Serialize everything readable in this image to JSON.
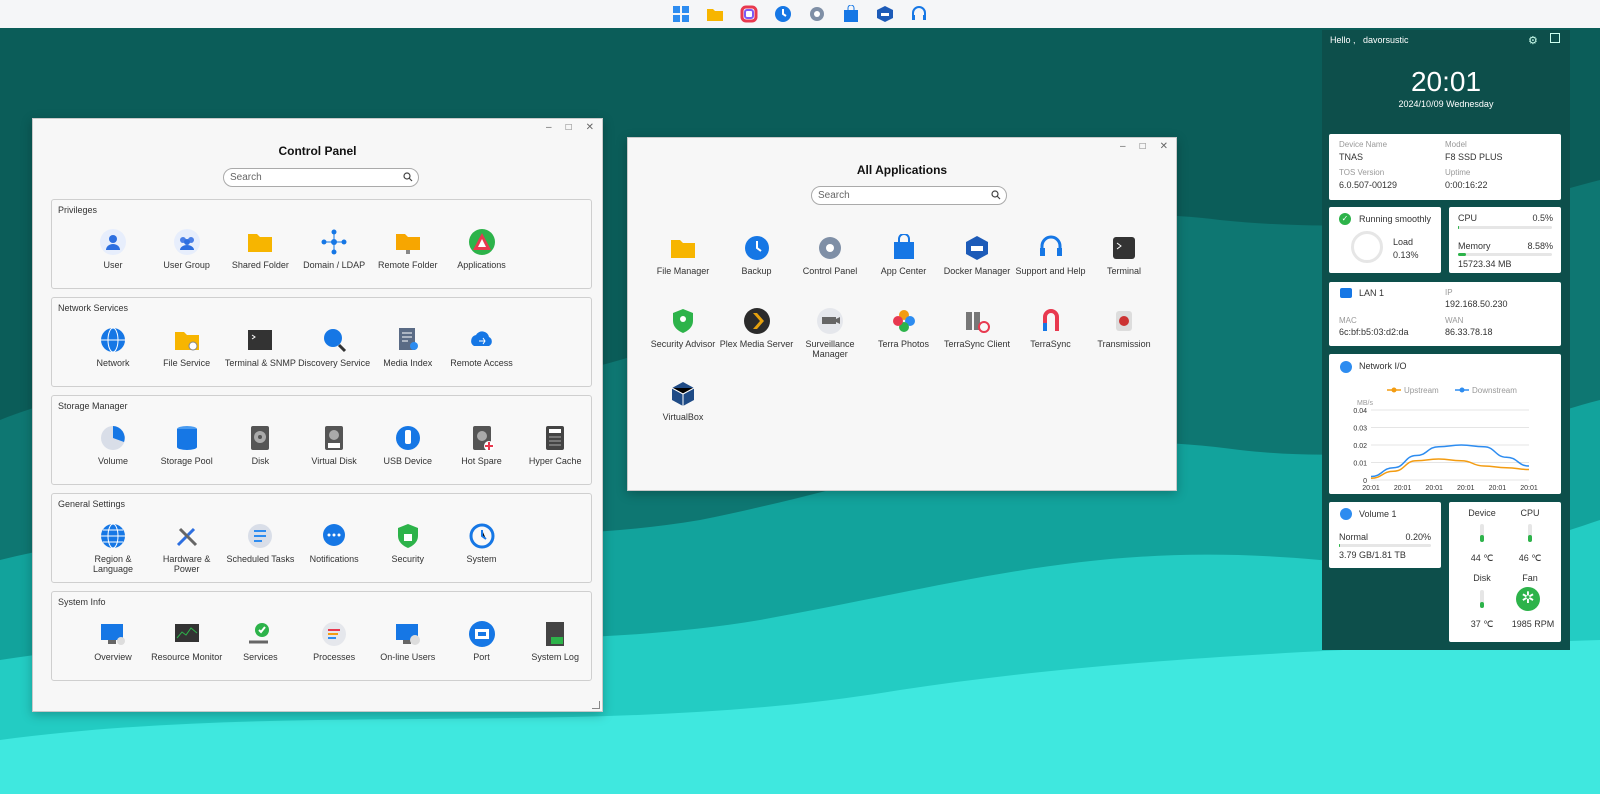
{
  "taskbar": {
    "icons": [
      "grid-apps-icon",
      "file-manager-icon",
      "app-center-icon",
      "backup-icon",
      "control-panel-icon",
      "shopping-bag-icon",
      "docker-icon",
      "headset-icon"
    ]
  },
  "control_panel": {
    "title": "Control Panel",
    "search_placeholder": "Search",
    "sections": [
      {
        "title": "Privileges",
        "items": [
          [
            "User",
            "user-icon"
          ],
          [
            "User Group",
            "user-group-icon"
          ],
          [
            "Shared Folder",
            "shared-folder-icon"
          ],
          [
            "Domain / LDAP",
            "domain-ldap-icon"
          ],
          [
            "Remote Folder",
            "remote-folder-icon"
          ],
          [
            "Applications",
            "applications-icon"
          ]
        ]
      },
      {
        "title": "Network Services",
        "items": [
          [
            "Network",
            "network-icon"
          ],
          [
            "File Service",
            "file-service-icon"
          ],
          [
            "Terminal & SNMP",
            "terminal-snmp-icon"
          ],
          [
            "Discovery Service",
            "discovery-service-icon"
          ],
          [
            "Media Index",
            "media-index-icon"
          ],
          [
            "Remote Access",
            "remote-access-icon"
          ]
        ]
      },
      {
        "title": "Storage Manager",
        "items": [
          [
            "Volume",
            "volume-icon"
          ],
          [
            "Storage Pool",
            "storage-pool-icon"
          ],
          [
            "Disk",
            "disk-icon"
          ],
          [
            "Virtual Disk",
            "virtual-disk-icon"
          ],
          [
            "USB Device",
            "usb-device-icon"
          ],
          [
            "Hot Spare",
            "hot-spare-icon"
          ],
          [
            "Hyper Cache",
            "hyper-cache-icon"
          ]
        ]
      },
      {
        "title": "General Settings",
        "items": [
          [
            "Region & Language",
            "region-language-icon"
          ],
          [
            "Hardware & Power",
            "hardware-power-icon"
          ],
          [
            "Scheduled Tasks",
            "scheduled-tasks-icon"
          ],
          [
            "Notifications",
            "notifications-icon"
          ],
          [
            "Security",
            "security-icon"
          ],
          [
            "System",
            "system-icon"
          ]
        ]
      },
      {
        "title": "System Info",
        "items": [
          [
            "Overview",
            "overview-icon"
          ],
          [
            "Resource Monitor",
            "resource-monitor-icon"
          ],
          [
            "Services",
            "services-icon"
          ],
          [
            "Processes",
            "processes-icon"
          ],
          [
            "On-line Users",
            "online-users-icon"
          ],
          [
            "Port",
            "port-icon"
          ],
          [
            "System Log",
            "system-log-icon"
          ]
        ]
      }
    ]
  },
  "all_apps": {
    "title": "All Applications",
    "search_placeholder": "Search",
    "apps": [
      [
        "File Manager",
        "file-manager-icon"
      ],
      [
        "Backup",
        "backup-icon"
      ],
      [
        "Control Panel",
        "control-panel-icon"
      ],
      [
        "App Center",
        "app-center-icon"
      ],
      [
        "Docker Manager",
        "docker-icon"
      ],
      [
        "Support and Help",
        "headset-icon"
      ],
      [
        "Terminal",
        "terminal-icon"
      ],
      [
        "Security Advisor",
        "security-advisor-icon"
      ],
      [
        "Plex Media Server",
        "plex-icon"
      ],
      [
        "Surveillance Manager",
        "surveillance-icon"
      ],
      [
        "Terra Photos",
        "terra-photos-icon"
      ],
      [
        "TerraSync Client",
        "terrasync-client-icon"
      ],
      [
        "TerraSync",
        "terrasync-icon"
      ],
      [
        "Transmission",
        "transmission-icon"
      ],
      [
        "VirtualBox",
        "virtualbox-icon"
      ]
    ]
  },
  "widget": {
    "hello": "Hello ,",
    "user": "davorsustic",
    "time": "20:01",
    "date": "2024/10/09 Wednesday",
    "device": {
      "name_label": "Device Name",
      "name": "TNAS",
      "model_label": "Model",
      "model": "F8 SSD PLUS",
      "tos_label": "TOS Version",
      "tos": "6.0.507-00129",
      "uptime_label": "Uptime",
      "uptime": "0:00:16:22"
    },
    "status": {
      "text": "Running smoothly",
      "load_label": "Load",
      "load": "0.13%"
    },
    "cpu": {
      "label": "CPU",
      "value": "0.5%",
      "fraction": 0.005
    },
    "memory": {
      "label": "Memory",
      "value": "8.58%",
      "fraction": 0.0858,
      "total": "15723.34 MB"
    },
    "lan": {
      "title": "LAN 1",
      "ip_label": "IP",
      "ip": "192.168.50.230",
      "mac_label": "MAC",
      "mac": "6c:bf:b5:03:d2:da",
      "wan_label": "WAN",
      "wan": "86.33.78.18"
    },
    "netio": {
      "title": "Network I/O",
      "unit": "MB/s",
      "legend": [
        "Upstream",
        "Downstream"
      ]
    },
    "volume": {
      "title": "Volume 1",
      "status": "Normal",
      "percent": "0.20%",
      "fraction": 0.002,
      "usage": "3.79 GB/1.81 TB"
    },
    "temps": {
      "device_label": "Device",
      "device": "44 ℃",
      "cpu_label": "CPU",
      "cpu": "46 ℃",
      "disk_label": "Disk",
      "disk": "37 ℃",
      "fan_label": "Fan",
      "fan": "1985 RPM"
    }
  },
  "chart_data": {
    "type": "line",
    "x": [
      "20:01",
      "20:01",
      "20:01",
      "20:01",
      "20:01",
      "20:01"
    ],
    "ylabel": "MB/s",
    "ylim": [
      0,
      0.04
    ],
    "yticks": [
      "0",
      "0.01",
      "0.02",
      "0.03",
      "0.04"
    ],
    "series": [
      {
        "name": "Upstream",
        "color": "#f39c12",
        "values": [
          0.001,
          0.005,
          0.011,
          0.012,
          0.011,
          0.008,
          0.007,
          0.006
        ]
      },
      {
        "name": "Downstream",
        "color": "#2d8cf0",
        "values": [
          0.002,
          0.007,
          0.014,
          0.019,
          0.02,
          0.019,
          0.013,
          0.008
        ]
      }
    ],
    "grid": true,
    "legend": "top"
  }
}
